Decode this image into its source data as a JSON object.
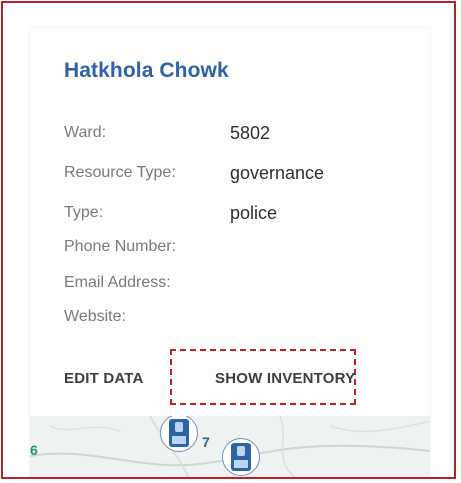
{
  "place": {
    "title": "Hatkhola Chowk"
  },
  "details": {
    "ward": {
      "label": "Ward:",
      "value": "5802"
    },
    "resource_type": {
      "label": "Resource Type:",
      "value": "governance"
    },
    "type": {
      "label": "Type:",
      "value": "police"
    },
    "phone": {
      "label": "Phone Number:",
      "value": ""
    },
    "email": {
      "label": "Email Address:",
      "value": ""
    },
    "website": {
      "label": "Website:",
      "value": ""
    }
  },
  "actions": {
    "edit_data": "EDIT DATA",
    "show_inventory": "SHOW INVENTORY"
  },
  "map": {
    "cluster_count": "7",
    "edge_label": "6",
    "marker_icon": "building-icon"
  },
  "colors": {
    "title": "#2f63a6",
    "frame_border": "#b8202a",
    "highlight_dash": "#c0202a",
    "label_text": "#7a7a7a",
    "value_text": "#2f2f2f"
  }
}
